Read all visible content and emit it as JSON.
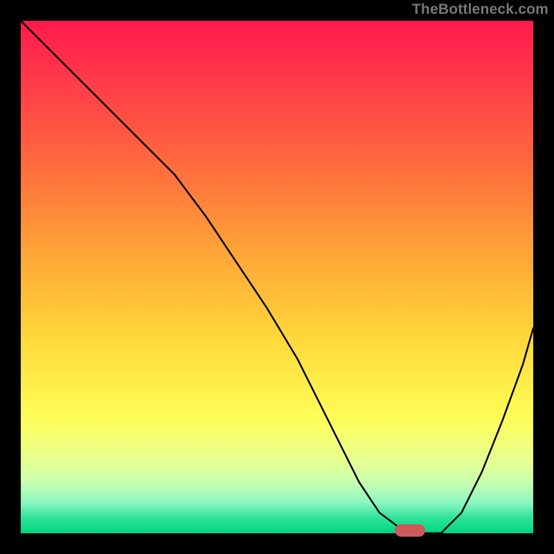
{
  "watermark": "TheBottleneck.com",
  "colors": {
    "page_bg": "#000000",
    "watermark": "#777777",
    "curve": "#000000",
    "marker": "#cc5a5a"
  },
  "chart_data": {
    "type": "line",
    "title": "",
    "xlabel": "",
    "ylabel": "",
    "xlim": [
      0,
      100
    ],
    "ylim": [
      0,
      100
    ],
    "x": [
      0,
      8,
      16,
      24,
      30,
      36,
      42,
      48,
      54,
      58,
      62,
      66,
      70,
      74,
      78,
      82,
      86,
      90,
      94,
      98,
      100
    ],
    "values": [
      100,
      92,
      84,
      76,
      70,
      62,
      53,
      44,
      34,
      26,
      18,
      10,
      4,
      1,
      0,
      0,
      4,
      12,
      22,
      33,
      40
    ],
    "marker": {
      "x": 76,
      "y": 0.5
    },
    "gradient_top": "#ff1a4d",
    "gradient_bottom": "#00d77e",
    "notes": "Heat-gradient background from red (high bottleneck) to green (optimal). Curve dips to near zero around x≈74–80 then rises."
  }
}
